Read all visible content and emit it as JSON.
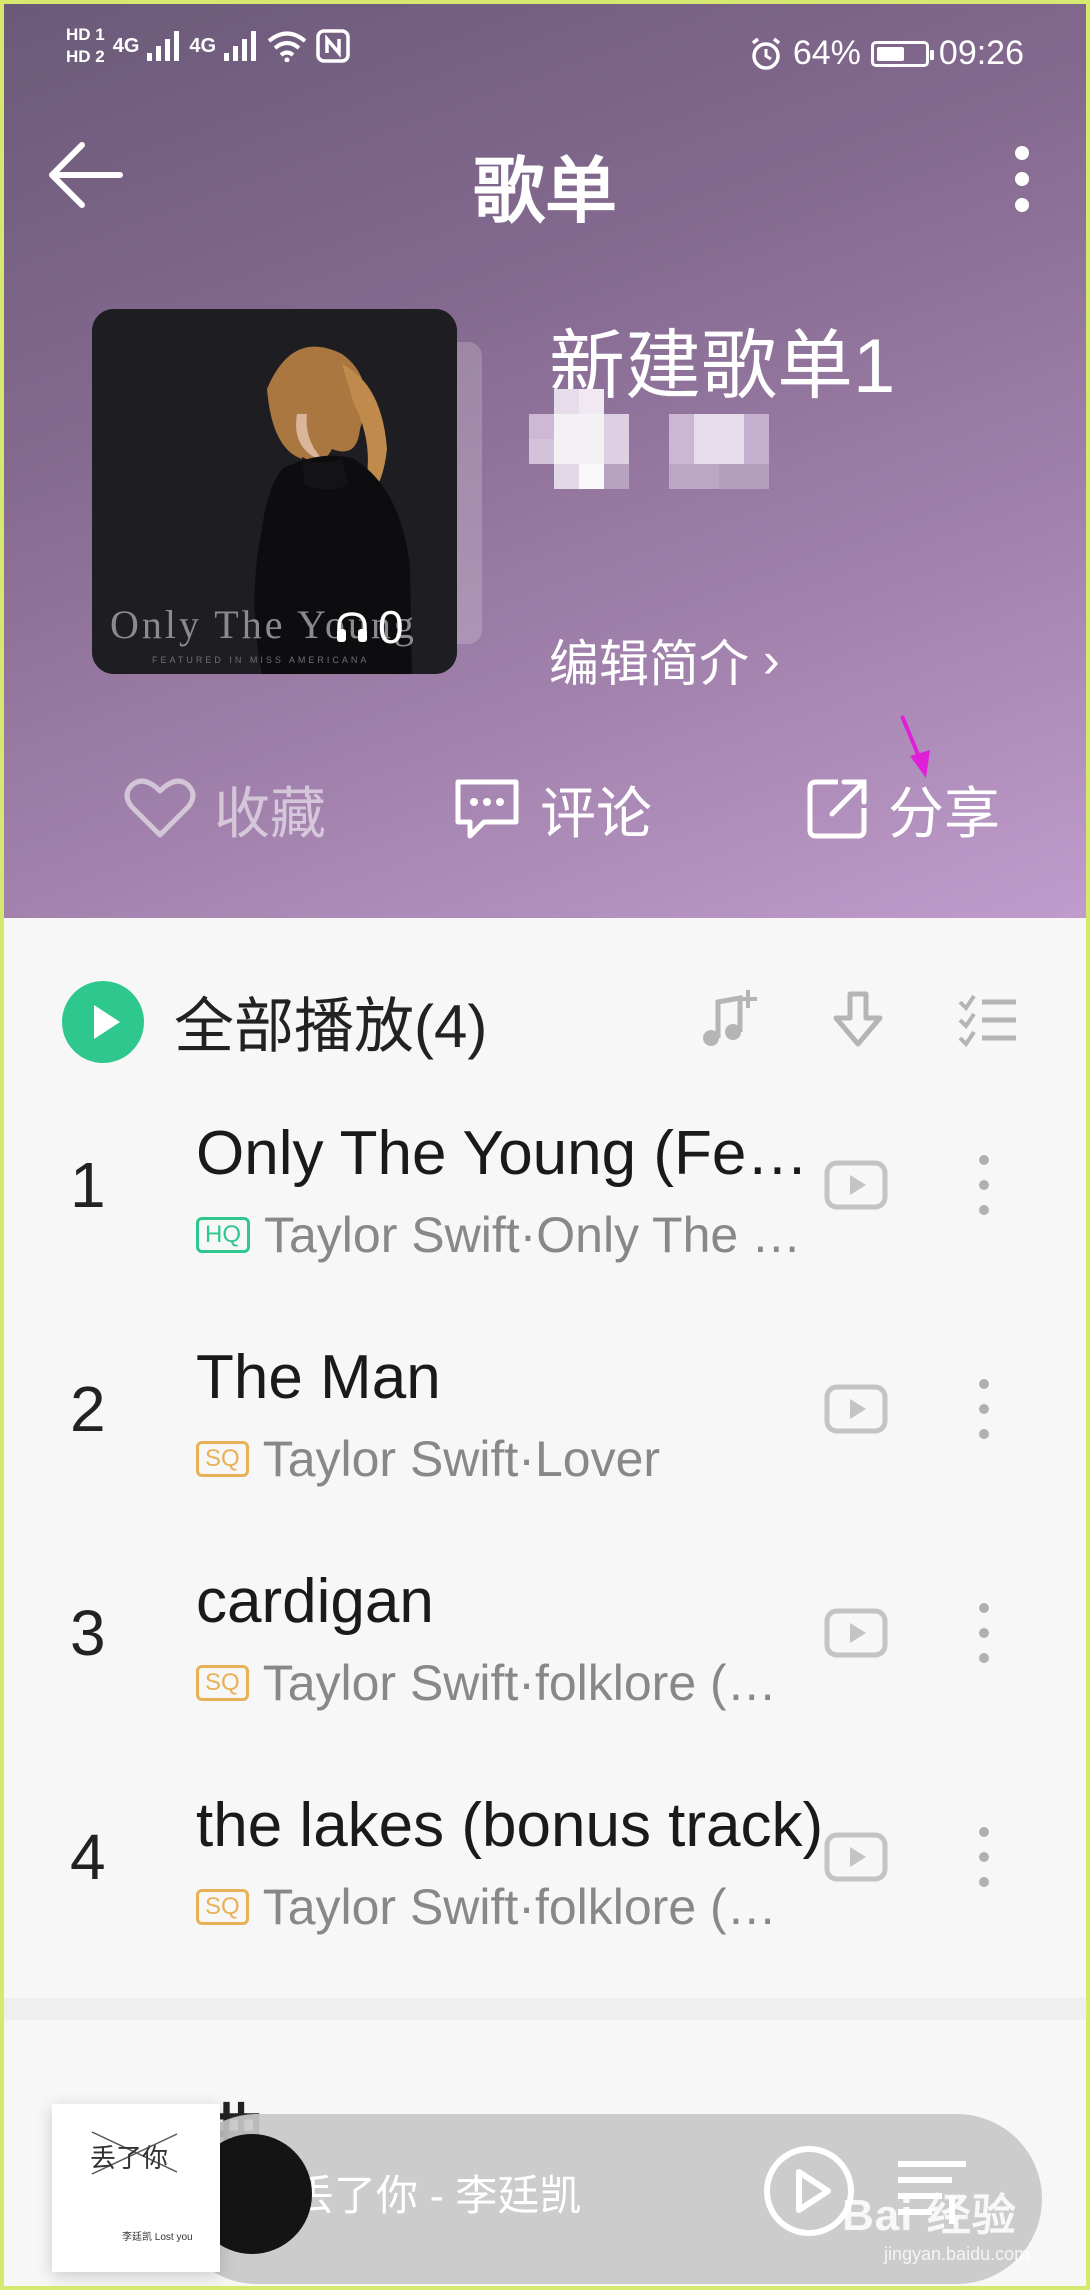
{
  "status_bar": {
    "hd1": "HD 1",
    "hd2": "HD 2",
    "net1": "4G",
    "net2": "4G",
    "battery": "64%",
    "battery_level": 0.64,
    "time": "09:26"
  },
  "nav": {
    "title": "歌单"
  },
  "playlist": {
    "cover_title": "Only The Young",
    "cover_subtitle": "FEATURED IN MISS AMERICANA",
    "play_count": "0",
    "name": "新建歌单1",
    "edit_intro": "编辑简介",
    "edit_intro_chevron": "›"
  },
  "actions": {
    "favorite": "收藏",
    "comment": "评论",
    "share": "分享"
  },
  "list": {
    "play_all": "全部播放(4)",
    "songs": [
      {
        "index": "1",
        "title": "Only The Young (Featured in Miss Americana)",
        "badge": "HQ",
        "artist": "Taylor Swift·Only The Young (Featured in Miss Americana)"
      },
      {
        "index": "2",
        "title": "The Man",
        "badge": "SQ",
        "artist": "Taylor Swift·Lover"
      },
      {
        "index": "3",
        "title": "cardigan",
        "badge": "SQ",
        "artist": "Taylor Swift·folklore (deluxe version)"
      },
      {
        "index": "4",
        "title": "the lakes (bonus track)",
        "badge": "SQ",
        "artist": "Taylor Swift·folklore (deluxe version)"
      }
    ]
  },
  "section_peek": "曲",
  "player": {
    "thumb_title": "丢了你",
    "thumb_small": "李廷凯 Lost you",
    "now_playing": "丢了你 - 李廷凯"
  },
  "watermark": {
    "text": "Bai 经验",
    "url": "jingyan.baidu.com"
  },
  "colors": {
    "accent_green": "#2ec88f",
    "sq_gold": "#e8b057",
    "annotation_arrow": "#e020d8"
  }
}
